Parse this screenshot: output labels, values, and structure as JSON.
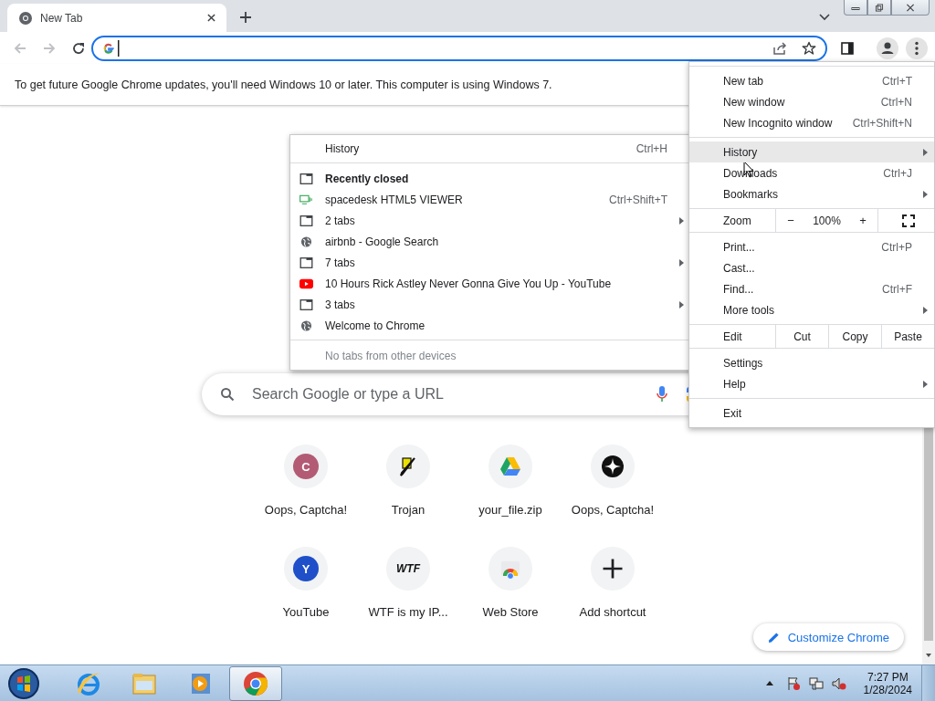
{
  "tabs": [
    {
      "title": "New Tab",
      "selected": true
    }
  ],
  "nav_buttons": [
    {
      "kind": "back",
      "disabled": true
    },
    {
      "kind": "forward",
      "disabled": true
    },
    {
      "kind": "reload",
      "disabled": false
    }
  ],
  "infobar": {
    "message": "To get future Google Chrome updates, you'll need Windows 10 or later. This computer is using Windows 7."
  },
  "search": {
    "placeholder": "Search Google or type a URL"
  },
  "shortcuts": [
    {
      "title": "Oops, Captcha!",
      "kind": "letter",
      "letter": "C",
      "color": "#b35b74"
    },
    {
      "title": "Trojan",
      "kind": "pen"
    },
    {
      "title": "your_file.zip",
      "kind": "drive"
    },
    {
      "title": "Oops, Captcha!",
      "kind": "sparkle"
    },
    {
      "title": "YouTube",
      "kind": "letter",
      "letter": "Y",
      "color": "#1f4fc9"
    },
    {
      "title": "WTF is my IP...",
      "kind": "text",
      "letter": "WTF"
    },
    {
      "title": "Web Store",
      "kind": "webstore"
    },
    {
      "title": "Add shortcut",
      "kind": "add"
    }
  ],
  "customize_button": {
    "label": "Customize Chrome"
  },
  "app_menu": {
    "sections": [
      [
        {
          "kind": "item",
          "label": "New tab",
          "shortcut": "Ctrl+T",
          "submenu": false,
          "selected": false
        },
        {
          "kind": "item",
          "label": "New window",
          "shortcut": "Ctrl+N",
          "submenu": false,
          "selected": false
        },
        {
          "kind": "item",
          "label": "New Incognito window",
          "shortcut": "Ctrl+Shift+N",
          "submenu": false,
          "selected": false
        }
      ],
      [
        {
          "kind": "item",
          "label": "History",
          "submenu": true,
          "selected": true
        },
        {
          "kind": "item",
          "label": "Downloads",
          "shortcut": "Ctrl+J",
          "submenu": false,
          "selected": false
        },
        {
          "kind": "item",
          "label": "Bookmarks",
          "submenu": true,
          "selected": false
        }
      ],
      [
        {
          "kind": "zoom",
          "label": "Zoom",
          "minus": "−",
          "value": "100%",
          "plus": "+"
        }
      ],
      [
        {
          "kind": "item",
          "label": "Print...",
          "shortcut": "Ctrl+P",
          "submenu": false,
          "selected": false
        },
        {
          "kind": "item",
          "label": "Cast...",
          "submenu": false,
          "selected": false
        },
        {
          "kind": "item",
          "label": "Find...",
          "shortcut": "Ctrl+F",
          "submenu": false,
          "selected": false
        },
        {
          "kind": "item",
          "label": "More tools",
          "submenu": true,
          "selected": false
        }
      ],
      [
        {
          "kind": "edit",
          "label": "Edit",
          "actions": [
            "Cut",
            "Copy",
            "Paste"
          ]
        }
      ],
      [
        {
          "kind": "item",
          "label": "Settings",
          "submenu": false,
          "selected": false
        },
        {
          "kind": "item",
          "label": "Help",
          "submenu": true,
          "selected": false
        }
      ],
      [
        {
          "kind": "item",
          "label": "Exit",
          "submenu": false,
          "selected": false
        }
      ]
    ]
  },
  "history_menu": {
    "header": {
      "label": "History",
      "shortcut": "Ctrl+H"
    },
    "items": [
      {
        "kind": "heading",
        "label": "Recently closed",
        "submenu": false
      },
      {
        "kind": "screen",
        "label": "spacedesk HTML5 VIEWER",
        "shortcut": "Ctrl+Shift+T",
        "submenu": false
      },
      {
        "kind": "window",
        "label": "2 tabs",
        "submenu": true
      },
      {
        "kind": "globe",
        "label": "airbnb - Google Search",
        "submenu": false
      },
      {
        "kind": "window",
        "label": "7 tabs",
        "submenu": true
      },
      {
        "kind": "youtube",
        "label": "10 Hours Rick Astley Never Gonna Give You Up - YouTube",
        "submenu": false
      },
      {
        "kind": "window",
        "label": "3 tabs",
        "submenu": true
      },
      {
        "kind": "globe",
        "label": "Welcome to Chrome",
        "submenu": false
      }
    ],
    "footer": "No tabs from other devices"
  },
  "taskbar": {
    "apps": [
      {
        "kind": "ie",
        "selected": false
      },
      {
        "kind": "explorer",
        "selected": false
      },
      {
        "kind": "media",
        "selected": false
      },
      {
        "kind": "chrome",
        "selected": true
      }
    ],
    "time": "7:27 PM",
    "date": "1/28/2024"
  }
}
